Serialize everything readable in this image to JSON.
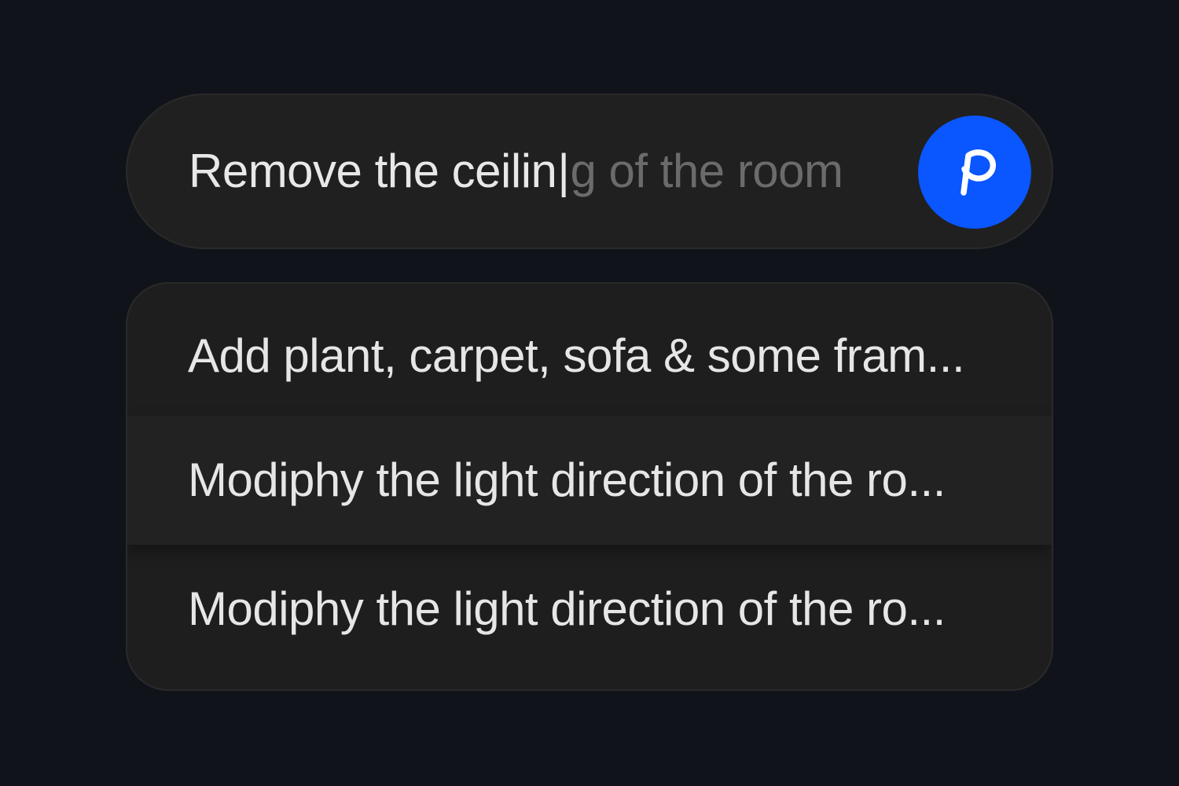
{
  "prompt": {
    "typed_text": "Remove the ceilin",
    "caret": "|",
    "ghost_completion": "g of the room",
    "submit_icon": "p-logo-icon",
    "accent_color": "#0a56ff"
  },
  "suggestions": [
    {
      "label": "Add plant, carpet, sofa & some fram..."
    },
    {
      "label": "Modiphy the light direction of the ro..."
    },
    {
      "label": "Modiphy the light  direction of the ro..."
    }
  ]
}
